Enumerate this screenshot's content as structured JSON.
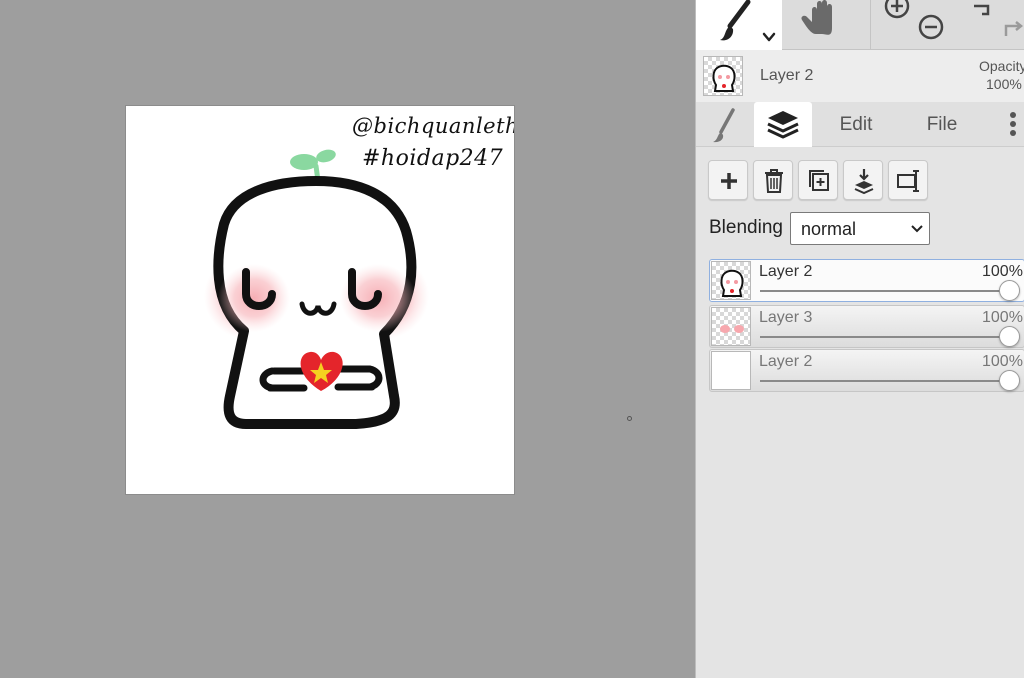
{
  "canvas": {
    "signature_line1": "@bichquanlethi",
    "signature_line2": "#hoidap247"
  },
  "panel": {
    "preview": {
      "layer_name": "Layer 2",
      "opacity_label": "Opacity",
      "opacity_value": "100%"
    },
    "tabs": [
      {
        "icon": "brush-icon"
      },
      {
        "icon": "layers-icon"
      },
      {
        "label": "Edit"
      },
      {
        "label": "File"
      },
      {
        "icon": "more-vertical-icon"
      }
    ],
    "actions": [
      "add-layer-icon",
      "delete-layer-icon",
      "duplicate-layer-icon",
      "merge-down-icon",
      "transform-layer-icon"
    ],
    "blending": {
      "label": "Blending",
      "value": "normal"
    },
    "layers": [
      {
        "name": "Layer 2",
        "opacity": "100%",
        "opacity_fraction": 1.0,
        "selected": true
      },
      {
        "name": "Layer 3",
        "opacity": "100%",
        "opacity_fraction": 1.0,
        "selected": false
      },
      {
        "name": "Layer 2",
        "opacity": "100%",
        "opacity_fraction": 1.0,
        "selected": false
      }
    ]
  },
  "colors": {
    "workspace_bg": "#9e9e9e",
    "panel_bg": "#e4e4e4",
    "selected_border": "#8fb0e0",
    "sprout": "#8ad8a0",
    "blush": "#f7a8ae",
    "heart": "#e4252b",
    "star": "#f5d020"
  }
}
